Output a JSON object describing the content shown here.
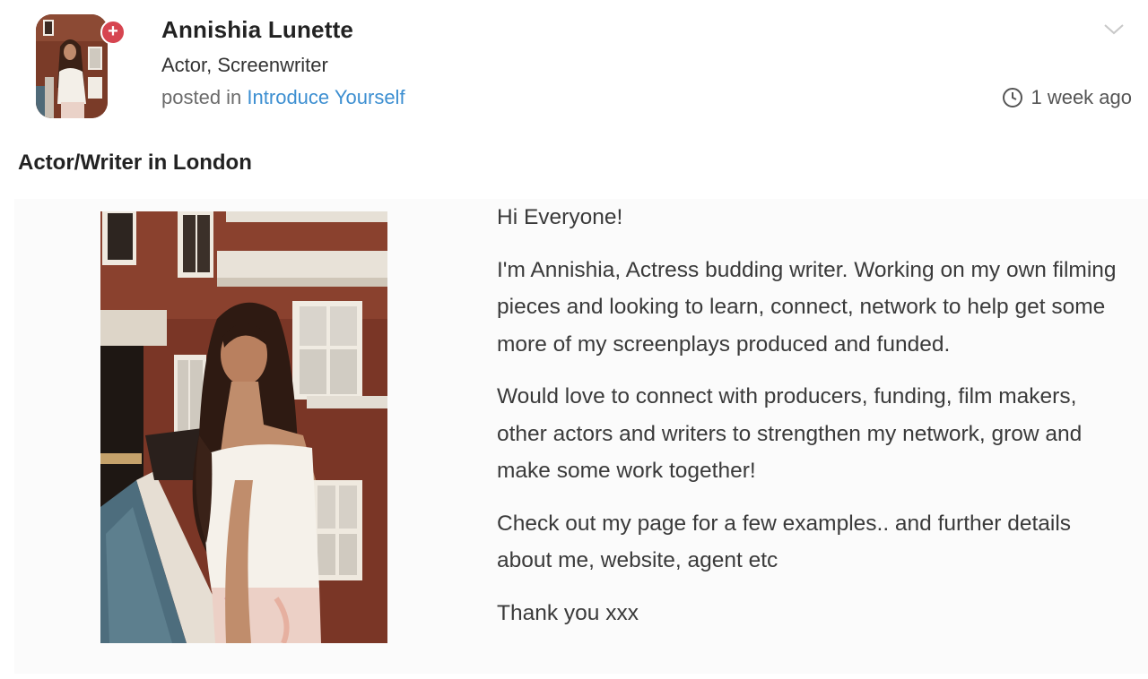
{
  "author": {
    "name": "Annishia Lunette",
    "role": "Actor, Screenwriter",
    "posted_in_prefix": "posted in",
    "category": "Introduce Yourself",
    "follow_icon": "plus-icon"
  },
  "meta": {
    "timestamp": "1 week ago",
    "time_icon": "clock-icon",
    "menu_icon": "chevron-down-icon"
  },
  "post": {
    "title": "Actor/Writer in London",
    "paragraphs": [
      "Hi Everyone!",
      "I'm Annishia, Actress budding writer. Working on my own filming pieces and looking to learn, connect, network to help get some more of my screenplays produced and funded.",
      "Would love to connect with producers, funding, film makers, other actors and writers to strengthen my network, grow and make some work together!",
      "Check out my page for a few examples.. and further details about me, website, agent etc",
      "Thank you xxx"
    ]
  },
  "colors": {
    "accent_link": "#3d8fd1",
    "badge": "#d64550"
  }
}
